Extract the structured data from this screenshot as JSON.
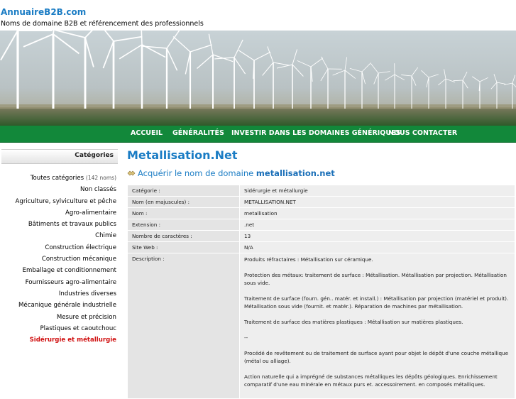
{
  "site": {
    "title": "AnnuaireB2B.com",
    "subtitle": "Noms de domaine B2B et référencement des professionnels"
  },
  "nav": [
    {
      "label": "ACCUEIL"
    },
    {
      "label": "GÉNÉRALITÉS"
    },
    {
      "label": "INVESTIR DANS LES DOMAINES GÉNÉRIQUES"
    },
    {
      "label": "NOUS CONTACTER"
    }
  ],
  "sidebar": {
    "header": "Catégories",
    "items": [
      {
        "label": "Toutes catégories",
        "count": "(142 noms)"
      },
      {
        "label": "Non classés"
      },
      {
        "label": "Agriculture, sylviculture et pêche"
      },
      {
        "label": "Agro-alimentaire"
      },
      {
        "label": "Bâtiments et travaux publics"
      },
      {
        "label": "Chimie"
      },
      {
        "label": "Construction électrique"
      },
      {
        "label": "Construction mécanique"
      },
      {
        "label": "Emballage et conditionnement"
      },
      {
        "label": "Fournisseurs agro-alimentaire"
      },
      {
        "label": "Industries diverses"
      },
      {
        "label": "Mécanique générale industrielle"
      },
      {
        "label": "Mesure et précision"
      },
      {
        "label": "Plastiques et caoutchouc"
      },
      {
        "label": "Sidérurgie et métallurgie",
        "active": true
      }
    ]
  },
  "main": {
    "title": "Metallisation.Net",
    "acquire_text": "Acquérir le nom de domaine",
    "acquire_domain": "metallisation.net",
    "rows": [
      {
        "key": "Catégorie :",
        "value": "Sidérurgie et métallurgie"
      },
      {
        "key": "Nom (en majuscules) :",
        "value": "METALLISATION.NET"
      },
      {
        "key": "Nom :",
        "value": "metallisation"
      },
      {
        "key": "Extension :",
        "value": ".net"
      },
      {
        "key": "Nombre de caractères :",
        "value": "13"
      },
      {
        "key": "Site Web :",
        "value": "N/A"
      }
    ],
    "description_key": "Description :",
    "description": [
      "Produits réfractaires : Métallisation sur céramique.",
      "Protection des métaux: traitement de surface : Métallisation. Métallisation par projection. Métallisation sous vide.",
      "Traitement de surface (fourn. gén.. matér. et install.) : Métallisation par projection (matériel et produit). Métallisation sous vide (fournit. et matér.). Réparation de machines par métallisation.",
      "Traitement de surface des matières plastiques : Métallisation sur matières plastiques.",
      "--",
      "Procédé de revêtement ou de traitement de surface ayant pour objet le dépôt d'une couche métallique (métal ou alliage).",
      "Action naturelle qui a imprégné de substances métalliques les dépôts géologiques. Enrichissement comparatif d'une eau minérale en métaux purs et. accessoirement. en composés métalliques."
    ]
  },
  "colors": {
    "accent": "#1a7cc4",
    "nav_bg": "#12883a",
    "active_category": "#d01010"
  }
}
